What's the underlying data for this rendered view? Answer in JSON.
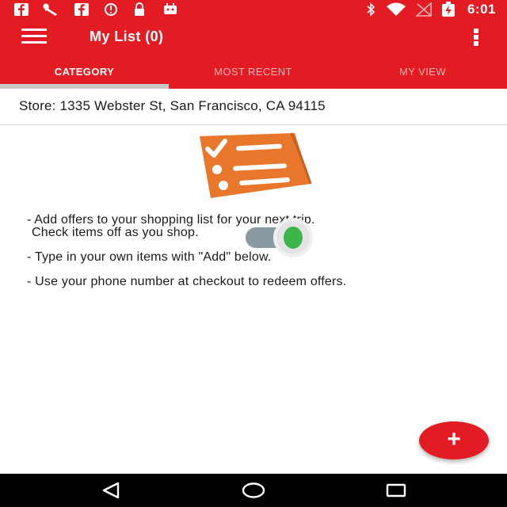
{
  "status_bar": {
    "time": "6:01",
    "icons": [
      "facebook-icon",
      "wrench-icon",
      "facebook-icon",
      "alert-icon",
      "lock-icon",
      "android-icon",
      "bluetooth-icon",
      "wifi-icon",
      "no-signal-icon",
      "battery-charging-icon"
    ]
  },
  "app_bar": {
    "title": "My List (0)"
  },
  "tabs": [
    {
      "label": "CATEGORY",
      "active": true
    },
    {
      "label": "MOST RECENT",
      "active": false
    },
    {
      "label": "MY VIEW",
      "active": false
    }
  ],
  "store": {
    "text": "Store: 1335 Webster St, San Francisco, CA 94115"
  },
  "instructions": {
    "line1": "- Add offers to your shopping list for your next trip.",
    "line2": "Check items off as you shop.",
    "line3": "- Type in your own items with \"Add\" below.",
    "line4": "- Use your phone number at checkout to redeem offers."
  },
  "colors": {
    "brand_red": "#e31b23",
    "illustration_orange": "#e8762b",
    "toggle_green": "#3cb54a",
    "toggle_track": "#8a9aa2"
  },
  "fab": {
    "label": "+"
  }
}
